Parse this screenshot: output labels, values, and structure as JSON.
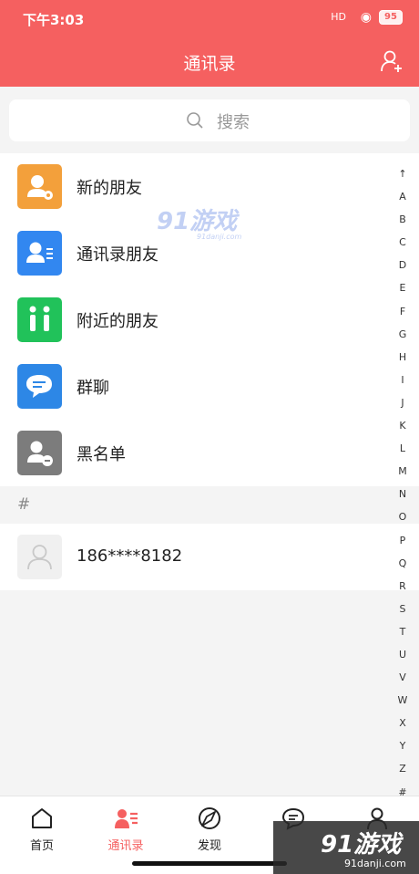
{
  "status": {
    "time": "下午3:03",
    "battery": "95",
    "signal": "HD"
  },
  "header": {
    "title": "通讯录"
  },
  "search": {
    "placeholder": "搜索"
  },
  "menu": [
    {
      "label": "新的朋友",
      "color": "#f3a03b",
      "icon": "new-friend-icon"
    },
    {
      "label": "通讯录朋友",
      "color": "#3287f0",
      "icon": "contacts-card-icon"
    },
    {
      "label": "附近的朋友",
      "color": "#21c25a",
      "icon": "nearby-people-icon"
    },
    {
      "label": "群聊",
      "color": "#2d87e6",
      "icon": "group-chat-icon"
    },
    {
      "label": "黑名单",
      "color": "#7c7c7c",
      "icon": "blacklist-icon"
    }
  ],
  "section": {
    "header": "#"
  },
  "contacts": [
    {
      "label": "186****8182"
    }
  ],
  "index": [
    "↑",
    "A",
    "B",
    "C",
    "D",
    "E",
    "F",
    "G",
    "H",
    "I",
    "J",
    "K",
    "L",
    "M",
    "N",
    "O",
    "P",
    "Q",
    "R",
    "S",
    "T",
    "U",
    "V",
    "W",
    "X",
    "Y",
    "Z",
    "#"
  ],
  "tabs": [
    {
      "label": "首页",
      "icon": "home-icon"
    },
    {
      "label": "通讯录",
      "icon": "contacts-icon",
      "active": true
    },
    {
      "label": "发现",
      "icon": "discover-icon"
    },
    {
      "label": "",
      "icon": "message-icon"
    },
    {
      "label": "",
      "icon": "profile-icon"
    }
  ],
  "watermark": {
    "top": "91游戏",
    "top_sub": "91danji.com",
    "bottom": "91游戏",
    "bottom_sub": "91danji.com"
  },
  "colors": {
    "accent": "#f56060",
    "background": "#f4f4f4"
  }
}
